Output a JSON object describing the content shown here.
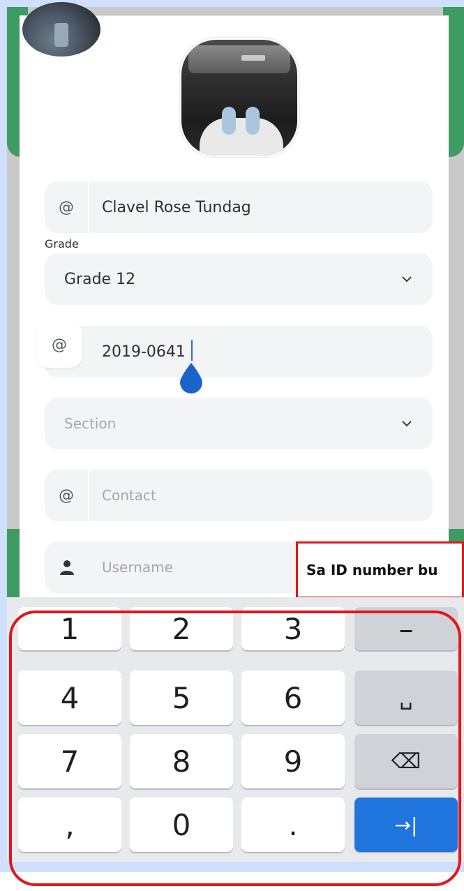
{
  "form": {
    "name": {
      "prefix": "@",
      "value": "Clavel Rose Tundag"
    },
    "grade": {
      "label": "Grade",
      "value": "Grade 12"
    },
    "id_number": {
      "prefix": "@",
      "value": "2019-0641"
    },
    "section": {
      "placeholder": "Section"
    },
    "contact": {
      "prefix": "@",
      "placeholder": "Contact"
    },
    "username": {
      "placeholder": "Username"
    }
  },
  "annotation": {
    "text": "Sa ID number bu"
  },
  "keyboard": {
    "row1": [
      "1",
      "2",
      "3",
      "–"
    ],
    "row2": [
      "4",
      "5",
      "6",
      "␣"
    ],
    "row3": [
      "7",
      "8",
      "9",
      "⌫"
    ],
    "row4": [
      ",",
      "0",
      ".",
      "→|"
    ]
  },
  "colors": {
    "accent_green": "#3e9b63",
    "highlight_red": "#e0161b",
    "key_action_blue": "#1f74de"
  }
}
